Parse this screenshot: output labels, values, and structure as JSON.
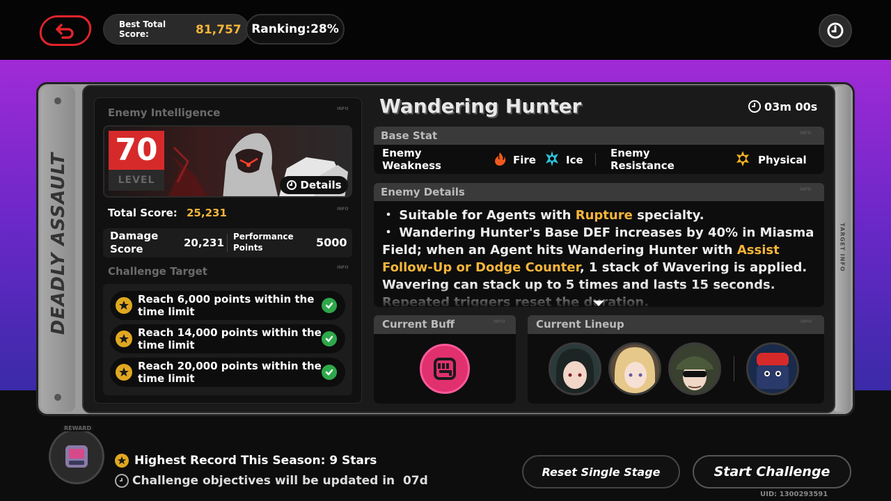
{
  "header": {
    "best_score_label": "Best Total Score:",
    "best_score_value": "81,757",
    "ranking": "Ranking:28%"
  },
  "side_rail": {
    "title": "DEADLY ASSAULT",
    "right_label": "TARGET INFO"
  },
  "enemy_intel": {
    "title": "Enemy Intelligence",
    "info_tag": "INFO",
    "level": "70",
    "level_label": "LEVEL",
    "details_label": "Details",
    "total_score_label": "Total Score:",
    "total_score_value": "25,231",
    "damage_label": "Damage Score",
    "damage_value": "20,231",
    "performance_label": "Performance Points",
    "performance_value": "5000"
  },
  "challenge": {
    "title": "Challenge Target",
    "targets": [
      "Reach 6,000 points within the time limit",
      "Reach 14,000 points within the time limit",
      "Reach 20,000 points within the time limit"
    ]
  },
  "boss": {
    "name": "Wandering Hunter",
    "timer": "03m 00s"
  },
  "base_stat": {
    "title": "Base Stat",
    "weakness_label": "Enemy Weakness",
    "weakness": [
      "Fire",
      "Ice"
    ],
    "resistance_label": "Enemy Resistance",
    "resistance": "Physical"
  },
  "enemy_details": {
    "title": "Enemy Details",
    "line1_pre": "・ Suitable for Agents with ",
    "line1_hl": "Rupture",
    "line1_post": " specialty.",
    "line2_pre": "・ Wandering Hunter's Base DEF increases by 40% in Miasma Field; when an Agent hits Wandering Hunter with ",
    "line2_hl": "Assist Follow-Up or Dodge Counter",
    "line2_post": ", 1 stack of Wavering is applied. Wavering can stack up to 5 times and lasts 15 seconds. Repeated triggers reset the duration."
  },
  "buff": {
    "title": "Current Buff"
  },
  "lineup": {
    "title": "Current Lineup"
  },
  "footer": {
    "reward_label": "REWARD",
    "highest_record": "Highest Record This Season: 9 Stars",
    "objectives": "Challenge objectives will be updated in  07d",
    "reset_label": "Reset Single Stage",
    "start_label": "Start Challenge",
    "uid": "UID: 1300293591"
  },
  "colors": {
    "accent_gold": "#f5b53a",
    "level_red": "#d62a2a",
    "check_green": "#2ea84a",
    "buff_pink": "#e0306e"
  }
}
